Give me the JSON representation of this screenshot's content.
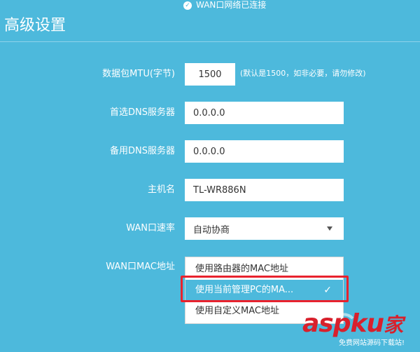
{
  "status": {
    "text": "WAN口网络已连接"
  },
  "page": {
    "title": "高级设置"
  },
  "form": {
    "mtu": {
      "label": "数据包MTU(字节)",
      "value": "1500",
      "hint": "(默认是1500，如非必要，请勿修改)"
    },
    "dns1": {
      "label": "首选DNS服务器",
      "value": "0.0.0.0"
    },
    "dns2": {
      "label": "备用DNS服务器",
      "value": "0.0.0.0"
    },
    "hostname": {
      "label": "主机名",
      "value": "TL-WR886N"
    },
    "wan_speed": {
      "label": "WAN口速率",
      "value": "自动协商"
    },
    "wan_mac": {
      "label": "WAN口MAC地址",
      "options": [
        "使用路由器的MAC地址",
        "使用当前管理PC的MA...",
        "使用自定义MAC地址"
      ],
      "selected_index": 1
    }
  },
  "watermark": {
    "brand": "aspku",
    "brand_suffix": "家",
    "slogan": "免费网站源码下载站!"
  },
  "colors": {
    "background": "#4db9dc",
    "highlight": "#e8222d",
    "watermark": "#d8202c"
  },
  "icons": {
    "status": "check-circle-icon",
    "select": "triangle-down-icon",
    "selected": "checkmark-icon"
  }
}
